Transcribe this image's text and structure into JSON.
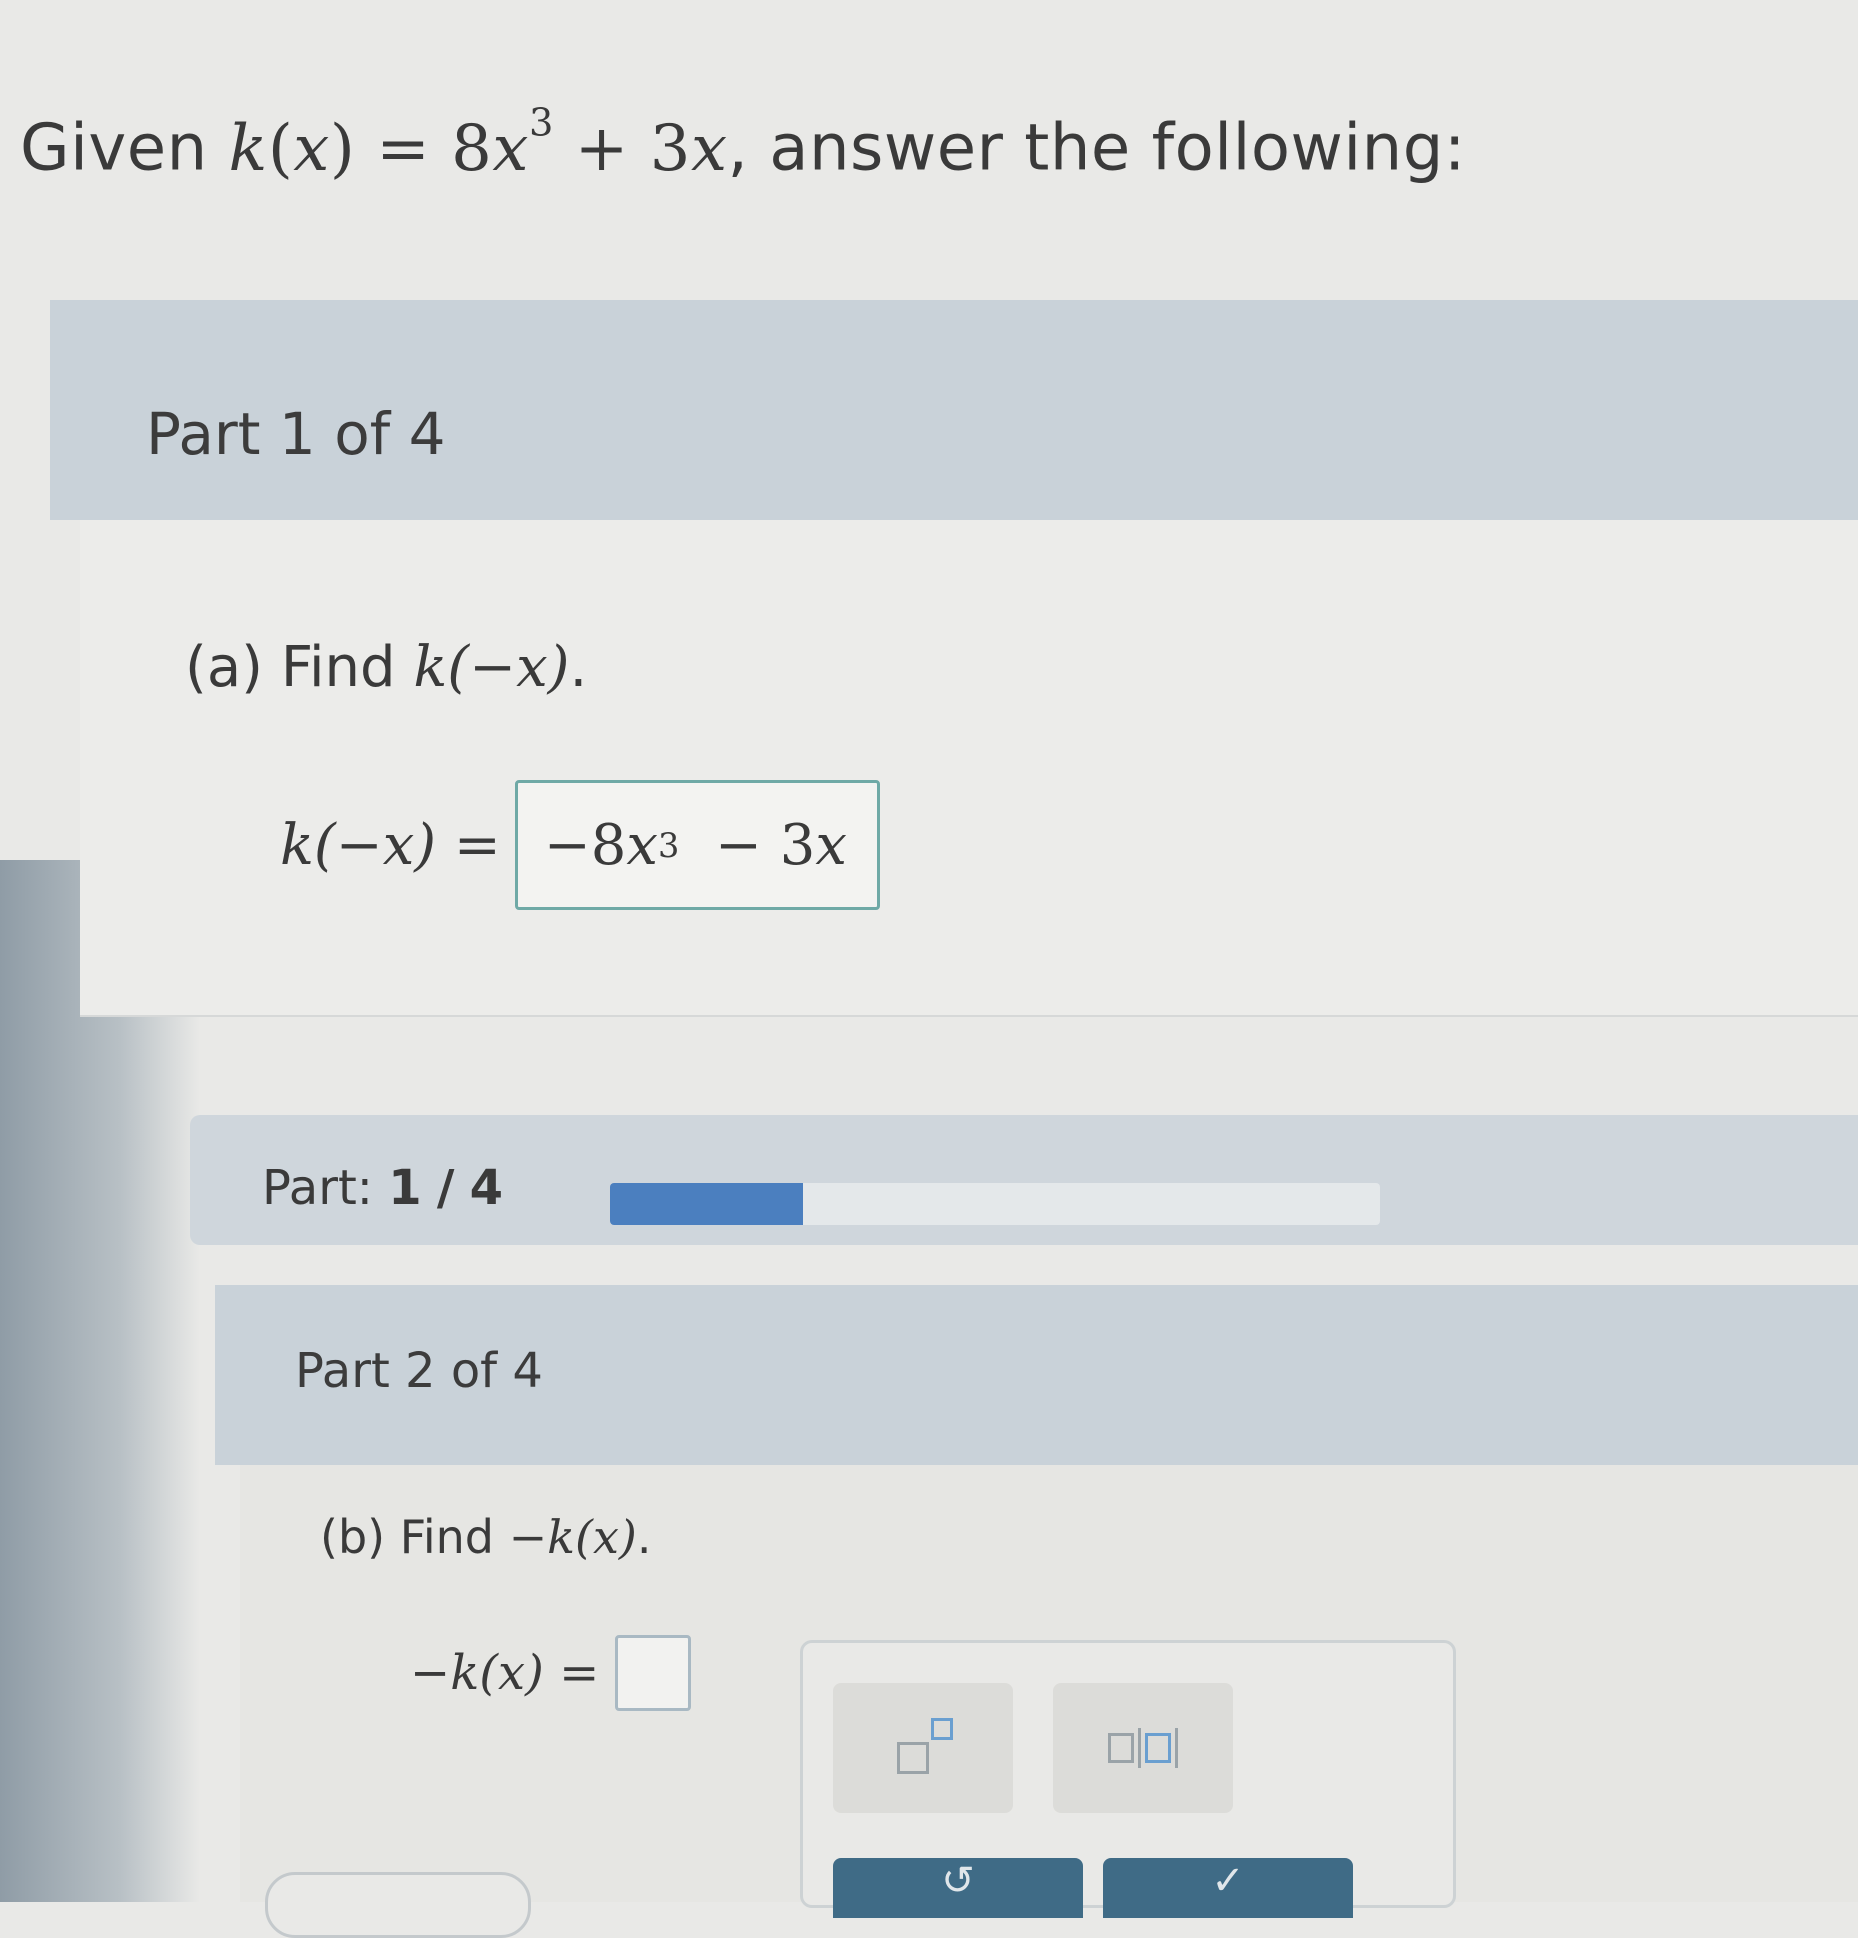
{
  "question": {
    "prefix": "Given ",
    "function_name": "k",
    "arg": "x",
    "coef": "8",
    "var": "x",
    "exp": "3",
    "plus_term": "+ 3",
    "plus_var": "x",
    "suffix": ", answer the following:"
  },
  "part1": {
    "label": "Part 1 of 4",
    "prompt_prefix": "(a) Find ",
    "prompt_math": "k(−x)",
    "prompt_suffix": ".",
    "lhs": "k(−x) =",
    "answer": {
      "term1": "−8",
      "var": "x",
      "exp": "3",
      "term2": "− 3",
      "var2": "x"
    }
  },
  "progress": {
    "label": "Part:",
    "current": "1",
    "sep": "/",
    "total": "4",
    "fraction": 0.25
  },
  "part2": {
    "label": "Part 2 of 4",
    "prompt_prefix": "(b) Find ",
    "prompt_math": "−k(x)",
    "prompt_suffix": ".",
    "lhs": "−k(x) =",
    "answer_value": ""
  },
  "palette": {
    "undo_icon": "undo-icon",
    "check_icon": "check-icon",
    "undo_glyph": "↺",
    "check_glyph": "✓"
  }
}
